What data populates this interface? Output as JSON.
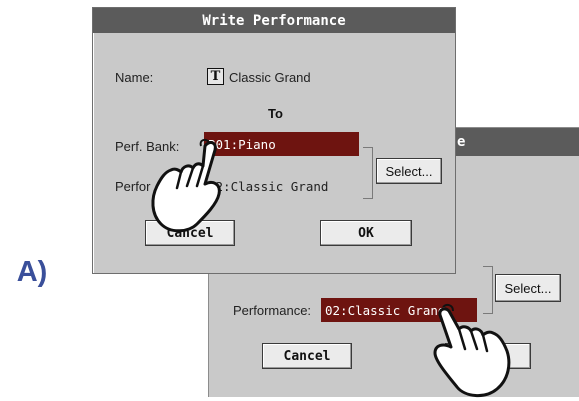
{
  "step_label": "A)",
  "front_dialog": {
    "title": "Write Performance",
    "name_label": "Name:",
    "name_icon": "T",
    "name_value": "Classic Grand",
    "to_label": "To",
    "bank_label": "Perf. Bank:",
    "bank_value": "B01:Piano",
    "performance_label": "Perfor",
    "performance_value": "02:Classic Grand",
    "select_button": "Select...",
    "cancel_button": "Cancel",
    "ok_button": "OK"
  },
  "back_dialog": {
    "title_fragment": "e",
    "performance_label": "Performance:",
    "performance_value": "02:Classic Grand",
    "select_button": "Select...",
    "cancel_button": "Cancel"
  },
  "colors": {
    "field_bg": "#6e1410",
    "titlebar_bg": "#5b5b5b",
    "dialog_bg": "#c9c9c9",
    "step_label": "#3a4f9a"
  },
  "icons": [
    "t-text-icon",
    "hand-pointer-icon"
  ]
}
